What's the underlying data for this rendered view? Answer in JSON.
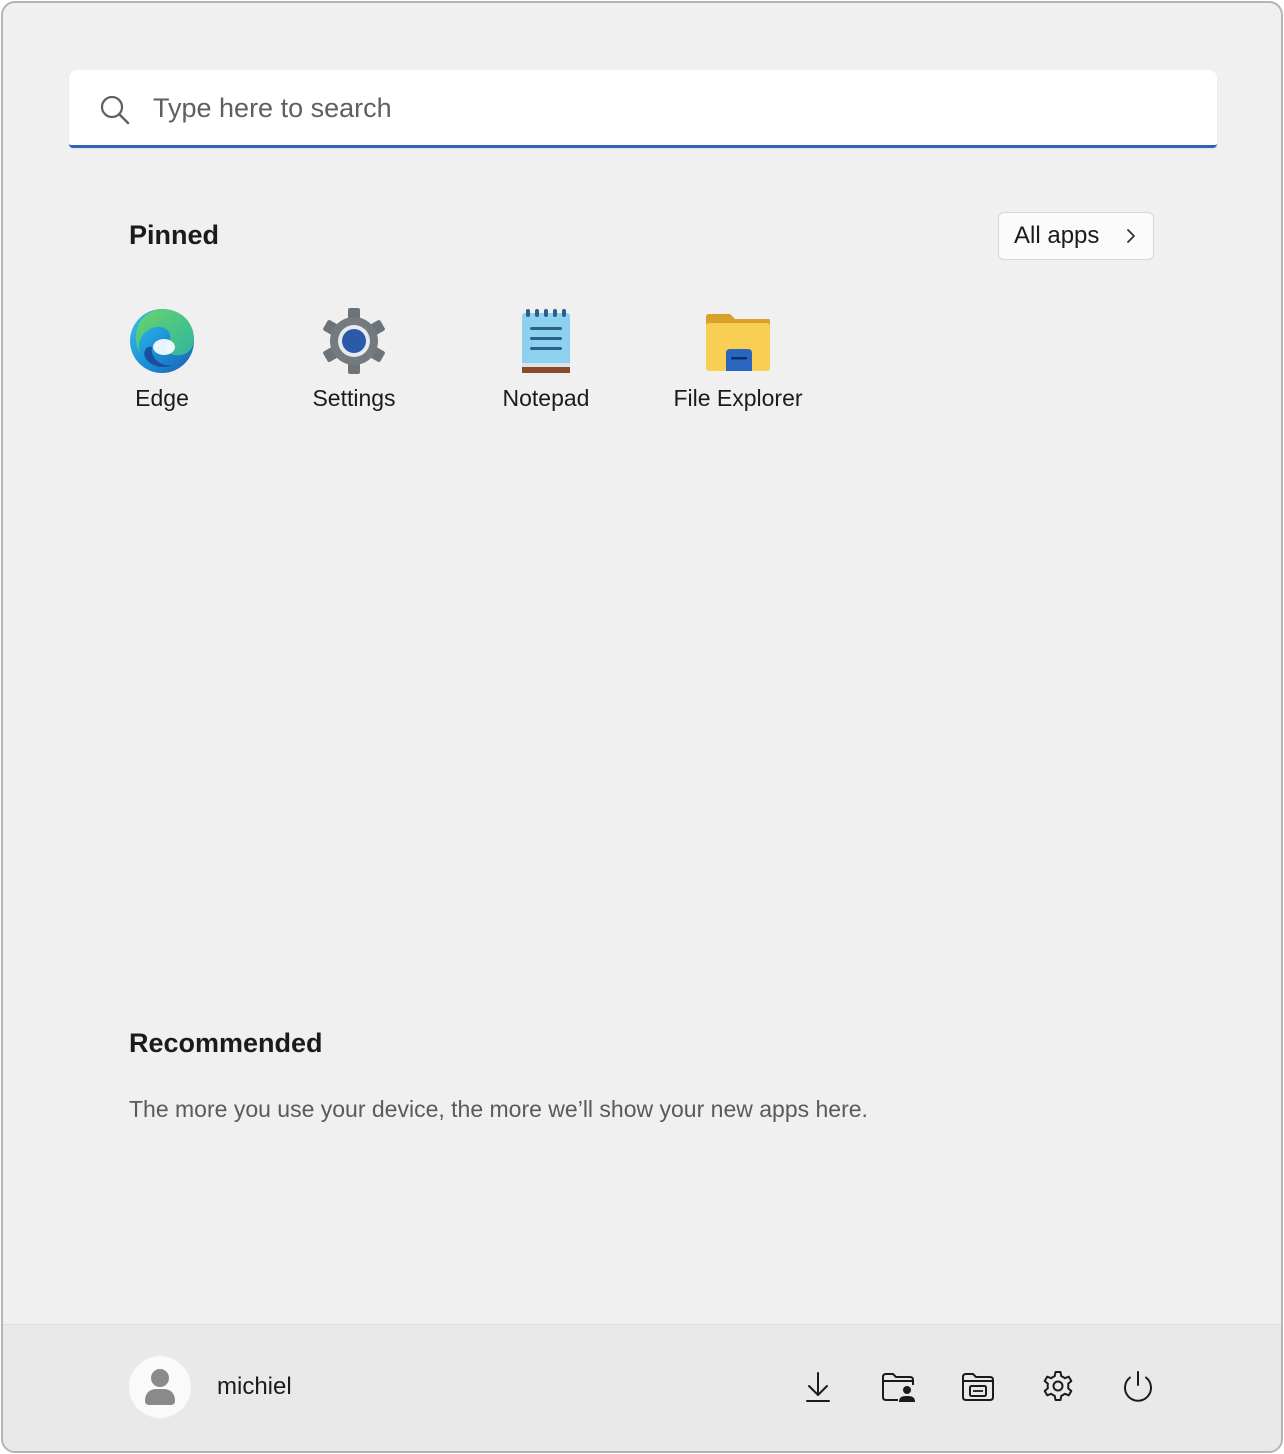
{
  "search": {
    "placeholder": "Type here to search",
    "accent_color": "#2f63b8",
    "icon": "search-icon"
  },
  "pinned": {
    "title": "Pinned",
    "all_apps_label": "All apps",
    "apps": [
      {
        "label": "Edge",
        "icon": "edge-icon"
      },
      {
        "label": "Settings",
        "icon": "settings-gear-icon"
      },
      {
        "label": "Notepad",
        "icon": "notepad-icon"
      },
      {
        "label": "File Explorer",
        "icon": "folder-icon"
      }
    ]
  },
  "recommended": {
    "title": "Recommended",
    "empty_message": "The more you use your device, the more we’ll show your new apps here."
  },
  "footer": {
    "user_name": "michiel",
    "icons": [
      "download-icon",
      "user-folder-icon",
      "documents-folder-icon",
      "gear-icon",
      "power-icon"
    ]
  }
}
